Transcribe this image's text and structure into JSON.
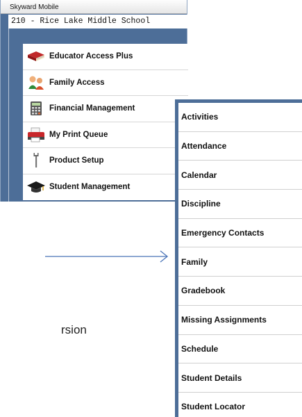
{
  "window": {
    "title": "Skyward Mobile",
    "school": "210 - Rice Lake Middle School",
    "accent_color": "#4d6e98"
  },
  "menu": {
    "items": [
      {
        "label": "Educator Access Plus",
        "icon": "book-icon"
      },
      {
        "label": "Family Access",
        "icon": "family-icon"
      },
      {
        "label": "Financial Management",
        "icon": "calculator-icon"
      },
      {
        "label": "My Print Queue",
        "icon": "printer-icon"
      },
      {
        "label": "Product Setup",
        "icon": "wrench-icon"
      },
      {
        "label": "Student Management",
        "icon": "graduation-cap-icon"
      }
    ]
  },
  "partial_text": "rsion",
  "submenu": {
    "items": [
      "Activities",
      "Attendance",
      "Calendar",
      "Discipline",
      "Emergency Contacts",
      "Family",
      "Gradebook",
      "Missing Assignments",
      "Schedule",
      "Student Details",
      "Student Locator"
    ]
  }
}
